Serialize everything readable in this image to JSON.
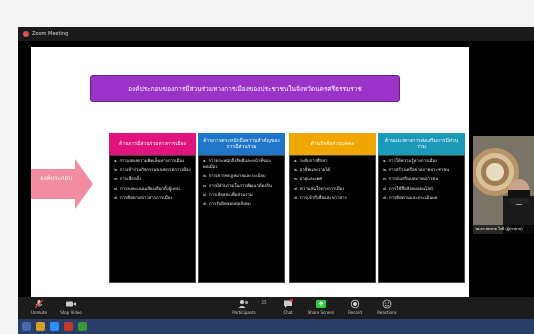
{
  "window": {
    "app_title": "Zoom Meeting"
  },
  "slide": {
    "title": "องค์ประกอบของการมีส่วนร่วมทางการเมืองของประชาชนในจังหวัดนครศรีธรรมราช",
    "arrow_label": "องค์ประกอบ",
    "columns": [
      {
        "header": "ด้านการมีส่วนร่วมทางการเมือง",
        "items": [
          "๑. การแสดงความคิดเห็นทางการเมือง",
          "๒. การเข้าร่วมกิจกรรมของพรรคการเมือง",
          "๓. การเลือกตั้ง",
          "๔. การลงคะแนนเสียงเลือกตั้งผู้แทน",
          "๕. การติดตามข่าวสารการเมือง"
        ]
      },
      {
        "header": "ด้านการตระหนักถึงความสำคัญของการมีส่วนร่วม",
        "items": [
          "๑. การตระหนักถึงสิทธิและหน้าที่ของพลเมือง",
          "๒. การเคารพกฎหมายและระเบียบ",
          "๓. การมีส่วนร่วมในการพัฒนาท้องถิ่น",
          "๔. การเสียสละเพื่อส่วนรวม",
          "๕. การรับผิดชอบต่อสังคม"
        ]
      },
      {
        "header": "ด้านปัจจัยส่วนบุคคล",
        "items": [
          "๑. ระดับการศึกษา",
          "๒. อาชีพและรายได้",
          "๓. อายุและเพศ",
          "๔. ความสนใจทางการเมือง",
          "๕. การเข้าถึงสื่อและข่าวสาร"
        ]
      },
      {
        "header": "ด้านแนวทางการส่งเสริมการมีส่วนร่วม",
        "items": [
          "๑. การให้ความรู้ทางการเมือง",
          "๒. การสร้างเครือข่ายภาคประชาชน",
          "๓. การส่งเสริมบทบาทเยาวชน",
          "๔. การใช้สื่อสังคมออนไลน์",
          "๕. การติดตามและประเมินผล"
        ]
      }
    ]
  },
  "participant": {
    "name": "รศ.ดร.สมชาย ใจดี (ผู้บรรยาย)"
  },
  "toolbar": {
    "unmute": "Unmute",
    "stop_video": "Stop Video",
    "participants": "Participants",
    "participants_count": "25",
    "chat": "Chat",
    "share_screen": "Share Screen",
    "record": "Record",
    "reactions": "Reactions"
  },
  "colors": {
    "title_purple": "#9c33c8",
    "arrow_pink": "#f28ca3",
    "col_magenta": "#e0147c",
    "col_blue": "#1f75c8",
    "col_yellow": "#f0a800",
    "col_teal": "#1b9ab8",
    "share_green": "#2ecc40"
  }
}
